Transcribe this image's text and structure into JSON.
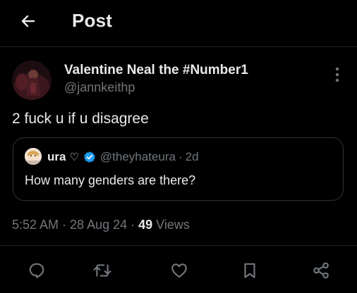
{
  "header": {
    "title": "Post",
    "back_icon": "arrow-left-icon"
  },
  "post": {
    "author": {
      "display_name": "Valentine Neal the #Number1",
      "handle": "@jannkeithp"
    },
    "text": "2 fuck u if u disagree",
    "quoted": {
      "name": "ura",
      "name_symbol": "♡",
      "handle": "@theyhateura",
      "separator": "·",
      "time": "2d",
      "text": "How many genders are there?"
    },
    "meta": {
      "time": "5:52 AM",
      "sep1": " · ",
      "date": "28 Aug 24",
      "sep2": " · ",
      "views_count": "49",
      "views_label": " Views"
    }
  },
  "actions": [
    "reply-icon",
    "repost-icon",
    "like-icon",
    "bookmark-icon",
    "share-icon"
  ],
  "colors": {
    "background": "#000000",
    "text_primary": "#e7e9ea",
    "text_secondary": "#71767b",
    "border": "#2f3336",
    "verified_blue": "#1d9bf0"
  }
}
